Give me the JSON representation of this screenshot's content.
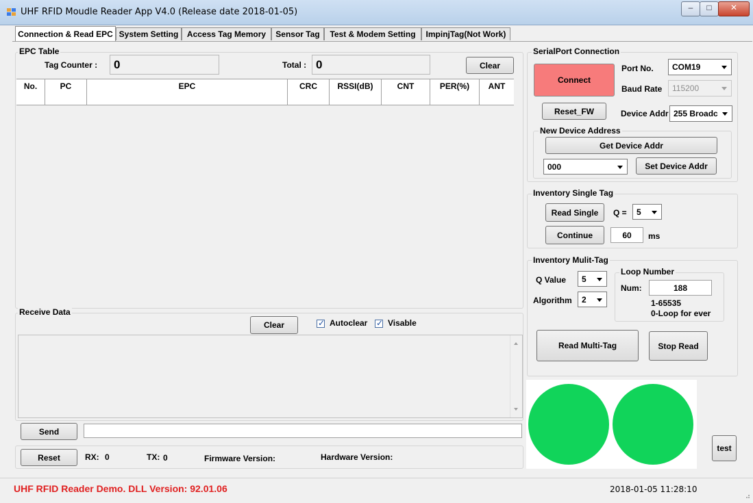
{
  "window": {
    "title": "UHF RFID Moudle Reader App V4.0 (Release date 2018-01-05)",
    "buttons": {
      "minimize": "–",
      "maximize": "□",
      "close": "✕"
    }
  },
  "tabs": [
    {
      "label": "Connection & Read EPC",
      "active": true
    },
    {
      "label": "System Setting"
    },
    {
      "label": "Access Tag Memory"
    },
    {
      "label": "Sensor Tag"
    },
    {
      "label": "Test & Modem Setting"
    },
    {
      "label": "ImpinjTag(Not Work)"
    }
  ],
  "epc_table": {
    "group_title": "EPC Table",
    "tag_counter_label": "Tag Counter :",
    "tag_counter_value": "0",
    "total_label": "Total :",
    "total_value": "0",
    "clear_label": "Clear",
    "columns": [
      "No.",
      "PC",
      "EPC",
      "CRC",
      "RSSI(dB)",
      "CNT",
      "PER(%)",
      "ANT"
    ]
  },
  "receive": {
    "group_title": "Receive Data",
    "clear_label": "Clear",
    "autoclear_label": "Autoclear",
    "autoclear_checked": true,
    "visable_label": "Visable",
    "visable_checked": true
  },
  "send": {
    "label": "Send",
    "value": ""
  },
  "bottom": {
    "reset_label": "Reset",
    "rx_label": "RX:",
    "rx_value": "0",
    "tx_label": "TX:",
    "tx_value": "0",
    "firmware_label": "Firmware Version:",
    "hardware_label": "Hardware Version:"
  },
  "serial": {
    "group_title": "SerialPort Connection",
    "connect_label": "Connect",
    "connect_color": "#f77b7b",
    "port_label": "Port No.",
    "port_value": "COM19",
    "baud_label": "Baud Rate",
    "baud_value": "115200",
    "reset_fw_label": "Reset_FW",
    "device_addr_label": "Device Addr",
    "device_addr_value": "255 Broadc"
  },
  "new_device": {
    "group_title": "New Device Address",
    "get_label": "Get Device Addr",
    "addr_value": "000",
    "set_label": "Set Device Addr"
  },
  "single": {
    "group_title": "Inventory Single Tag",
    "read_single_label": "Read Single",
    "q_label": "Q =",
    "q_value": "5",
    "continue_label": "Continue",
    "interval_value": "60",
    "interval_unit": "ms"
  },
  "multi": {
    "group_title": "Inventory Mulit-Tag",
    "q_label": "Q Value",
    "q_value": "5",
    "algorithm_label": "Algorithm",
    "algorithm_value": "2",
    "loop_title": "Loop Number",
    "num_label": "Num:",
    "num_value": "188",
    "range_text": "1-65535",
    "loop_hint": "0-Loop for ever",
    "read_multi_label": "Read Multi-Tag",
    "stop_label": "Stop Read"
  },
  "test_label": "test",
  "lamp_color": "#11d45a",
  "status": {
    "left_text": "UHF RFID Reader Demo. DLL Version: 92.01.06",
    "left_color": "#e02020",
    "datetime": "2018-01-05 11:28:10"
  }
}
